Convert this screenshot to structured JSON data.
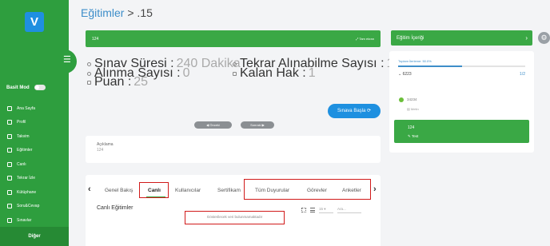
{
  "header": {
    "section": "Eğitimler",
    "crumb": "> .15"
  },
  "sidebar": {
    "logo": "V",
    "mode_label": "Basit Mod",
    "items": [
      {
        "label": "Ana Sayfa"
      },
      {
        "label": "Profil"
      },
      {
        "label": "Takvim"
      },
      {
        "label": "Eğitimler"
      },
      {
        "label": "Canlı"
      },
      {
        "label": "Tekrar İzle"
      },
      {
        "label": "Kütüphane"
      },
      {
        "label": "Soru&Cevap"
      },
      {
        "label": "Sınavlar"
      }
    ],
    "footer": "Diğer"
  },
  "course": {
    "code": "124",
    "action": "Tam ekran"
  },
  "info": {
    "exam_duration_label": "Sınav Süresi :",
    "exam_duration_value": "240 Dakika",
    "taken_label": "Alınma Sayısı :",
    "taken_value": "0",
    "points_label": "Puan :",
    "points_value": "25",
    "retake_label": "Tekrar Alınabilme Sayısı :",
    "retake_value": "1",
    "remaining_label": "Kalan Hak :",
    "remaining_value": "1"
  },
  "start_button": "Sınava Başla",
  "pills": {
    "prev": "Önceki",
    "next": "Sonraki"
  },
  "description": {
    "title": "Açıklama",
    "value": "124"
  },
  "tabs": [
    "Genel Bakış",
    "Canlı",
    "Kullanıcılar",
    "Sertifikam",
    "Tüm Duyurular",
    "Görevler",
    "Anketler"
  ],
  "live": {
    "title": "Canlı Eğitimler",
    "empty": "Gösterilecek veri bulunmamaktadır",
    "page_size": "15",
    "search_placeholder": "Ara..."
  },
  "right": {
    "content_title": "Eğitim İçeriği",
    "progress_label": "Toplam İlerleme: 50.0%",
    "progress": 0.5,
    "unit": "6223",
    "unit_count": "1/2",
    "item1": "34234",
    "item1_sub": "Metin",
    "item2": "124",
    "item2_sub": "Test"
  },
  "colors": {
    "green": "#3aa845",
    "blue": "#1e90e0",
    "red_highlight": "#d11a1a"
  }
}
